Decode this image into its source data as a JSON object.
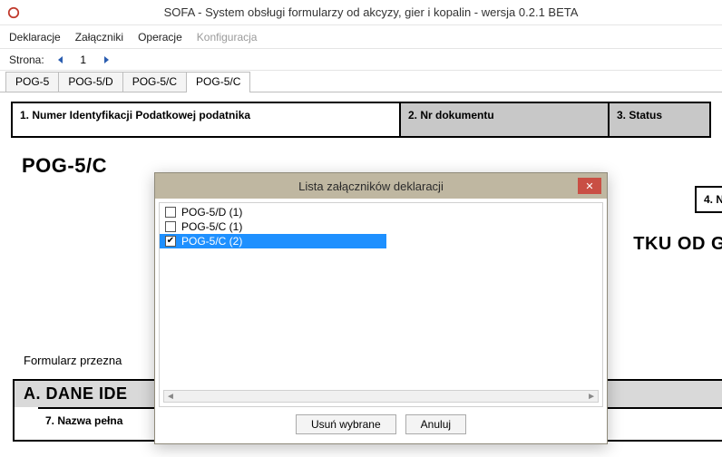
{
  "window": {
    "title": "SOFA - System obsługi formularzy od akcyzy, gier i kopalin - wersja 0.2.1 BETA"
  },
  "menu": {
    "items": [
      "Deklaracje",
      "Załączniki",
      "Operacje",
      "Konfiguracja"
    ],
    "disabled_index": 3
  },
  "pager": {
    "label": "Strona:",
    "page": "1"
  },
  "tabs": {
    "items": [
      "POG-5",
      "POG-5/D",
      "POG-5/C",
      "POG-5/C"
    ],
    "active_index": 3
  },
  "header_cells": {
    "c1": "1. Numer Identyfikacji Podatkowej podatnika",
    "c2": "2. Nr dokumentu",
    "c3": "3. Status"
  },
  "form_title": "POG-5/C",
  "side_box": "4. N",
  "big_cut_text": "TKU OD GIEI",
  "form_desc": "Formularz przezna",
  "section_a": {
    "header": "A. DANE IDE",
    "row7": "7. Nazwa pełna"
  },
  "modal": {
    "title": "Lista załączników deklaracji",
    "items": [
      {
        "label": "POG-5/D (1)",
        "checked": false,
        "selected": false
      },
      {
        "label": "POG-5/C (1)",
        "checked": false,
        "selected": false
      },
      {
        "label": "POG-5/C (2)",
        "checked": true,
        "selected": true
      }
    ],
    "btn_delete": "Usuń wybrane",
    "btn_cancel": "Anuluj"
  }
}
